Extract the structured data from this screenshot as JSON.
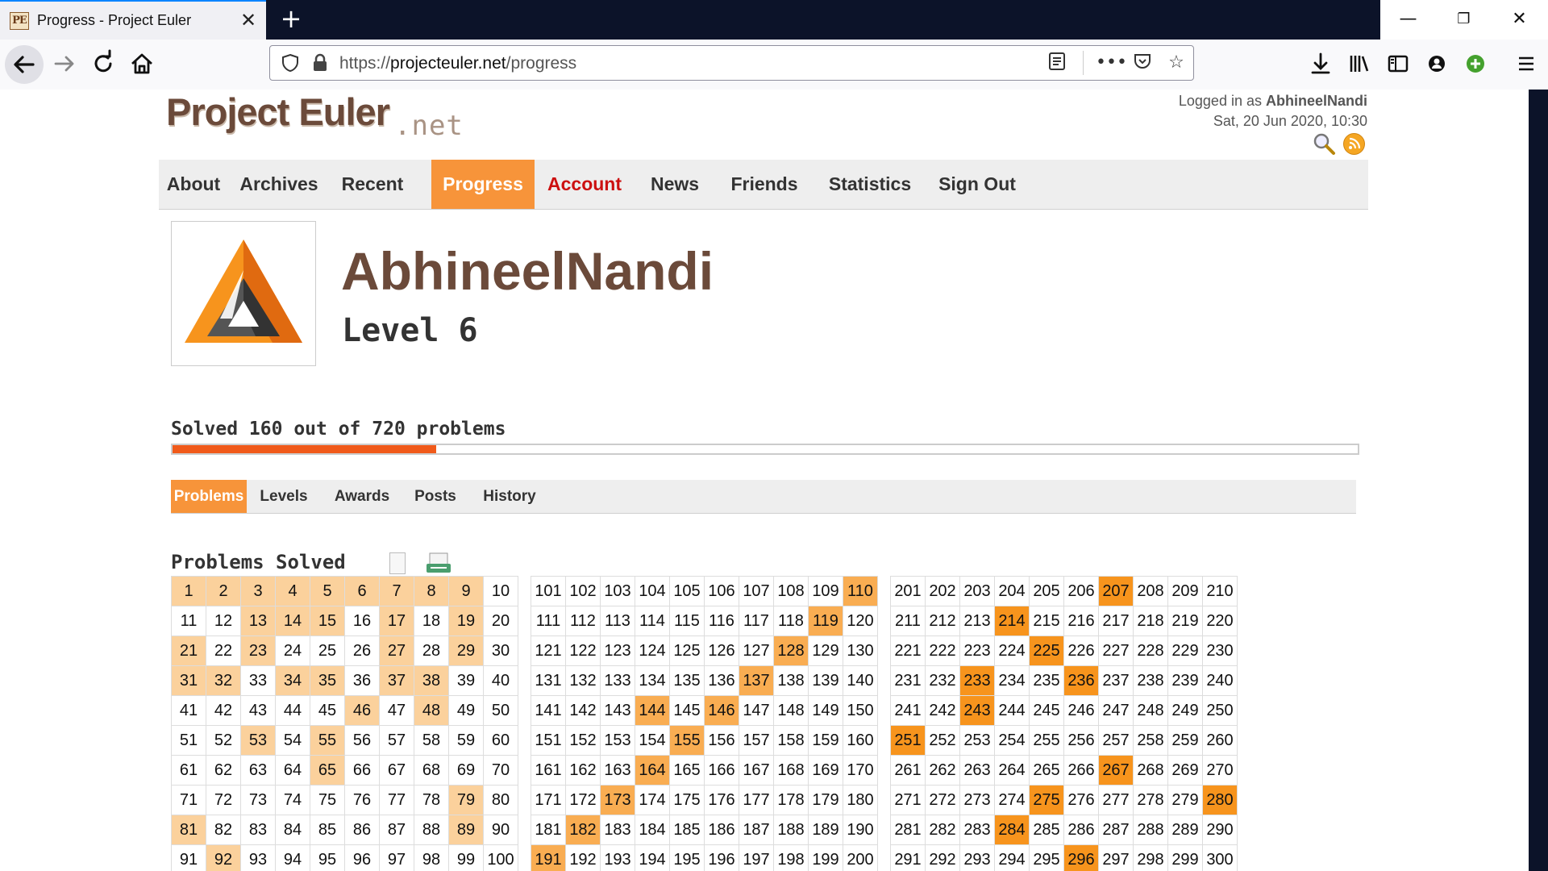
{
  "browser": {
    "tab_title": "Progress - Project Euler",
    "tab_close": "✕",
    "new_tab": "+",
    "url_scheme": "https://",
    "url_host": "projecteuler.net",
    "url_path": "/progress",
    "window_minimize": "—",
    "window_restore": "❐",
    "window_close": "✕"
  },
  "header": {
    "logo_main": "Project Euler",
    "logo_net": ".net",
    "logged_in_prefix": "Logged in as ",
    "logged_in_user": "AbhineelNandi",
    "datetime": "Sat, 20 Jun 2020, 10:30"
  },
  "menu": {
    "items": [
      {
        "label": "About"
      },
      {
        "label": "Archives"
      },
      {
        "label": "Recent"
      },
      {
        "label": "Progress"
      },
      {
        "label": "Account"
      },
      {
        "label": "News"
      },
      {
        "label": "Friends"
      },
      {
        "label": "Statistics"
      },
      {
        "label": "Sign Out"
      }
    ],
    "active": "Progress"
  },
  "profile": {
    "username": "AbhineelNandi",
    "level": "Level 6",
    "solved_text": "Solved 160 out of 720 problems",
    "solved": 160,
    "total": 720
  },
  "subtabs": {
    "items": [
      {
        "label": "Problems"
      },
      {
        "label": "Levels"
      },
      {
        "label": "Awards"
      },
      {
        "label": "Posts"
      },
      {
        "label": "History"
      }
    ],
    "active": "Problems"
  },
  "problems": {
    "title": "Problems Solved",
    "tier1": [
      1,
      2,
      3,
      4,
      5,
      6,
      7,
      8,
      9,
      13,
      14,
      15,
      17,
      19,
      21,
      23,
      27,
      29,
      31,
      32,
      34,
      35,
      37,
      38,
      46,
      48,
      53,
      55,
      65,
      79,
      81,
      89,
      92
    ],
    "tier2": [
      110,
      119,
      128,
      137,
      144,
      146,
      155,
      164,
      173,
      182,
      191
    ],
    "tier3": [
      207,
      214,
      225,
      233,
      236,
      243,
      251,
      267,
      275,
      280,
      284,
      296
    ]
  },
  "colors": {
    "accent": "#f7943a",
    "progress_fill": "#f05a1a",
    "brand_brown": "#6b4a3a",
    "account_red": "#cc1010",
    "solved_tier1": "#fbd19c",
    "solved_tier2": "#f9ad52",
    "solved_tier3": "#f7941d"
  }
}
